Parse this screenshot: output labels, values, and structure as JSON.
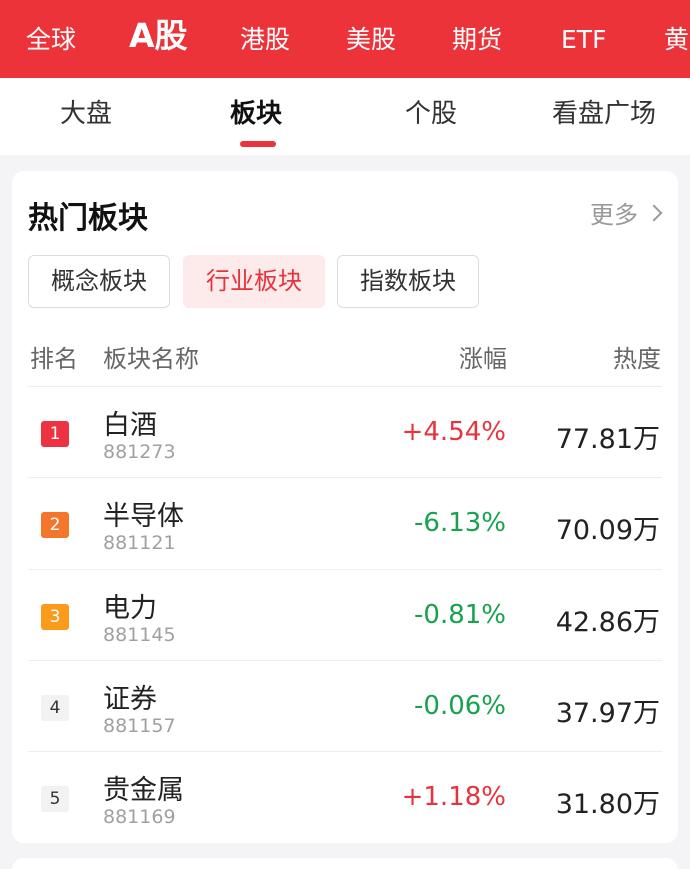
{
  "market_tabs": [
    "全球",
    "A股",
    "港股",
    "美股",
    "期货",
    "ETF",
    "黄"
  ],
  "market_active": "A股",
  "sub_tabs": [
    "大盘",
    "板块",
    "个股",
    "看盘广场"
  ],
  "sub_active": "板块",
  "card": {
    "title": "热门板块",
    "more": "更多",
    "filters": [
      "概念板块",
      "行业板块",
      "指数板块"
    ],
    "active_filter": "行业板块",
    "headers": {
      "rank": "排名",
      "name": "板块名称",
      "change": "涨幅",
      "heat": "热度"
    },
    "rows": [
      {
        "rank": "1",
        "name": "白酒",
        "code": "881273",
        "change": "+4.54%",
        "heat": "77.81万",
        "rank_color": "#ee3242",
        "dir": "up"
      },
      {
        "rank": "2",
        "name": "半导体",
        "code": "881121",
        "change": "-6.13%",
        "heat": "70.09万",
        "rank_color": "#f4752c",
        "dir": "down"
      },
      {
        "rank": "3",
        "name": "电力",
        "code": "881145",
        "change": "-0.81%",
        "heat": "42.86万",
        "rank_color": "#fa9b1c",
        "dir": "down"
      },
      {
        "rank": "4",
        "name": "证券",
        "code": "881157",
        "change": "-0.06%",
        "heat": "37.97万",
        "rank_color": "#f2f2f2",
        "dir": "down"
      },
      {
        "rank": "5",
        "name": "贵金属",
        "code": "881169",
        "change": "+1.18%",
        "heat": "31.80万",
        "rank_color": "#f2f2f2",
        "dir": "up"
      }
    ]
  },
  "colors": {
    "brand_red": "#eb3339",
    "up": "#e8333b",
    "down": "#17a34e"
  }
}
